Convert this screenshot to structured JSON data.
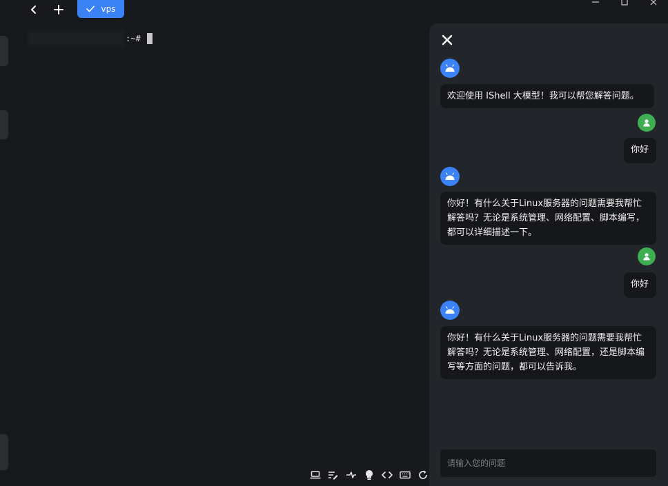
{
  "tabs": [
    {
      "label": "vps",
      "active": true
    }
  ],
  "terminal": {
    "prompt_suffix": ":~#"
  },
  "colors": {
    "accent": "#3b82f6",
    "user_avatar": "#3fae53",
    "background": "#17191c",
    "panel": "#222529"
  },
  "chat": {
    "messages": [
      {
        "role": "assistant",
        "text": "欢迎使用 IShell 大模型！我可以帮您解答问题。"
      },
      {
        "role": "user",
        "text": "你好"
      },
      {
        "role": "assistant",
        "text": "你好！有什么关于Linux服务器的问题需要我帮忙解答吗？无论是系统管理、网络配置、脚本编写，都可以详细描述一下。"
      },
      {
        "role": "user",
        "text": "你好"
      },
      {
        "role": "assistant",
        "text": "你好！有什么关于Linux服务器的问题需要我帮忙解答吗？无论是系统管理、网络配置，还是脚本编写等方面的问题，都可以告诉我。"
      }
    ],
    "input": {
      "placeholder": "请输入您的问题",
      "value": ""
    }
  },
  "toolbar_icons": [
    "laptop-icon",
    "edit-list-icon",
    "transfer-icon",
    "lightbulb-icon",
    "code-icon",
    "keyboard-icon",
    "refresh-icon"
  ]
}
